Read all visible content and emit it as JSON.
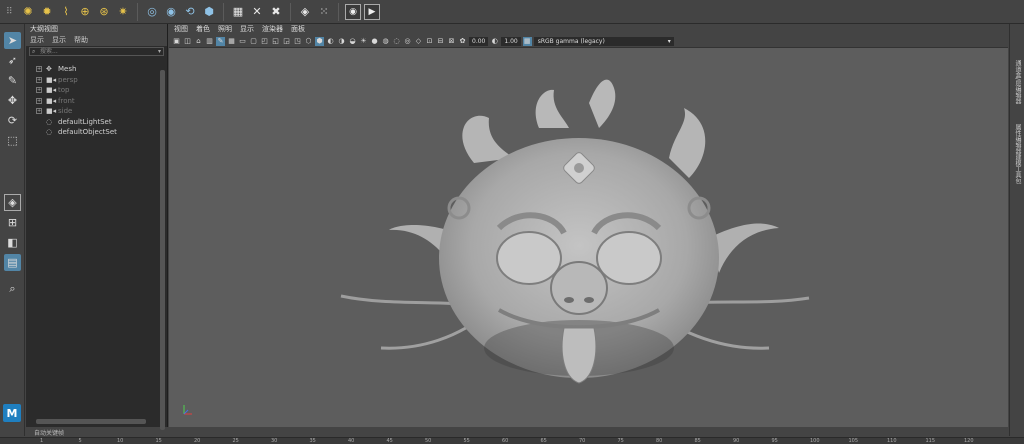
{
  "shelf": {
    "grip": "⠿",
    "groups": [
      [
        {
          "icon": "light-sun-icon",
          "glyph": "✺"
        },
        {
          "icon": "point-light-icon",
          "glyph": "✹"
        },
        {
          "icon": "directional-light-icon",
          "glyph": "⌇"
        },
        {
          "icon": "spot-light-icon",
          "glyph": "⊕"
        },
        {
          "icon": "area-light-icon",
          "glyph": "⊛"
        },
        {
          "icon": "volume-light-icon",
          "glyph": "✷"
        }
      ],
      [
        {
          "icon": "camera-icon",
          "glyph": "◎"
        },
        {
          "icon": "camera-aim-icon",
          "glyph": "◉"
        },
        {
          "icon": "render-settings-icon",
          "glyph": "⟲"
        },
        {
          "icon": "render-cube-icon",
          "glyph": "⬢"
        }
      ],
      [
        {
          "icon": "snap-grid-icon",
          "glyph": "▦"
        },
        {
          "icon": "snap-curve-icon",
          "glyph": "✕"
        },
        {
          "icon": "snap-point-icon",
          "glyph": "✖"
        }
      ],
      [
        {
          "icon": "pivot-icon",
          "glyph": "◈"
        },
        {
          "icon": "grid-toggle-icon",
          "glyph": "⁙"
        }
      ],
      [
        {
          "icon": "eye-icon",
          "glyph": "◉"
        },
        {
          "icon": "play-icon",
          "glyph": "▶"
        }
      ]
    ]
  },
  "outliner": {
    "title": "大纲视图",
    "menu": [
      "显示",
      "显示",
      "帮助"
    ],
    "search_placeholder": "搜索...",
    "items": [
      {
        "label": "Mesh",
        "icon": "✥",
        "expandable": true,
        "dim": false
      },
      {
        "label": "persp",
        "icon": "■◂",
        "expandable": true,
        "dim": true
      },
      {
        "label": "top",
        "icon": "■◂",
        "expandable": true,
        "dim": true
      },
      {
        "label": "front",
        "icon": "■◂",
        "expandable": true,
        "dim": true
      },
      {
        "label": "side",
        "icon": "■◂",
        "expandable": true,
        "dim": true
      },
      {
        "label": "defaultLightSet",
        "icon": "◌",
        "expandable": false,
        "dim": false
      },
      {
        "label": "defaultObjectSet",
        "icon": "◌",
        "expandable": false,
        "dim": false
      }
    ]
  },
  "viewport_panel": {
    "menu": [
      "视图",
      "着色",
      "照明",
      "显示",
      "渲染器",
      "面板"
    ],
    "exposure": "0.00",
    "gamma": "1.00",
    "color_space": "sRGB gamma (legacy)",
    "color_space_arrow": "▾"
  },
  "right_tabs": [
    "通道盒/层编辑器",
    "属性编辑器",
    "建模工具包"
  ],
  "timeline": {
    "label": "自动关键帧",
    "ticks": [
      "1",
      "5",
      "10",
      "15",
      "20",
      "25",
      "30",
      "35",
      "40",
      "45",
      "50",
      "55",
      "60",
      "65",
      "70",
      "75",
      "80",
      "85",
      "90",
      "95",
      "100",
      "105",
      "110",
      "115",
      "120"
    ]
  },
  "logo": "M",
  "colors": {
    "accent": "#5285a6",
    "viewport_bg": "#5d5d5d",
    "mesh": "#b9b9b9"
  }
}
